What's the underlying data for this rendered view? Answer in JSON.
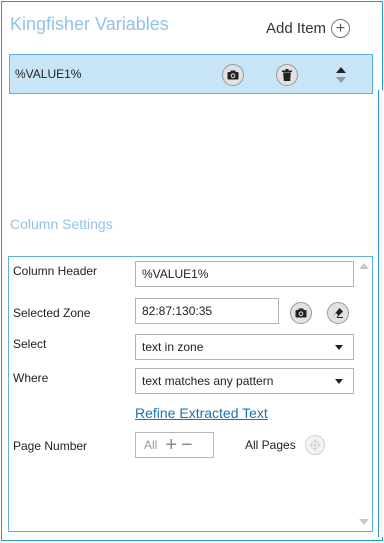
{
  "header": {
    "title": "Kingfisher Variables",
    "add_item_label": "Add Item"
  },
  "variables": [
    {
      "name": "%VALUE1%"
    }
  ],
  "column_settings": {
    "title": "Column Settings",
    "column_header": {
      "label": "Column Header",
      "value": "%VALUE1%"
    },
    "selected_zone": {
      "label": "Selected Zone",
      "value": "82:87:130:35"
    },
    "select": {
      "label": "Select",
      "value": "text in zone"
    },
    "where": {
      "label": "Where",
      "value": "text matches any pattern"
    },
    "refine_link": "Refine Extracted Text",
    "page_number": {
      "label": "Page Number",
      "value": "All",
      "all_pages_label": "All Pages"
    }
  },
  "colors": {
    "accent": "#2a95c6",
    "selected_row": "#c8e5f8",
    "title_text": "#8fc5e4",
    "link": "#1a73b8"
  }
}
